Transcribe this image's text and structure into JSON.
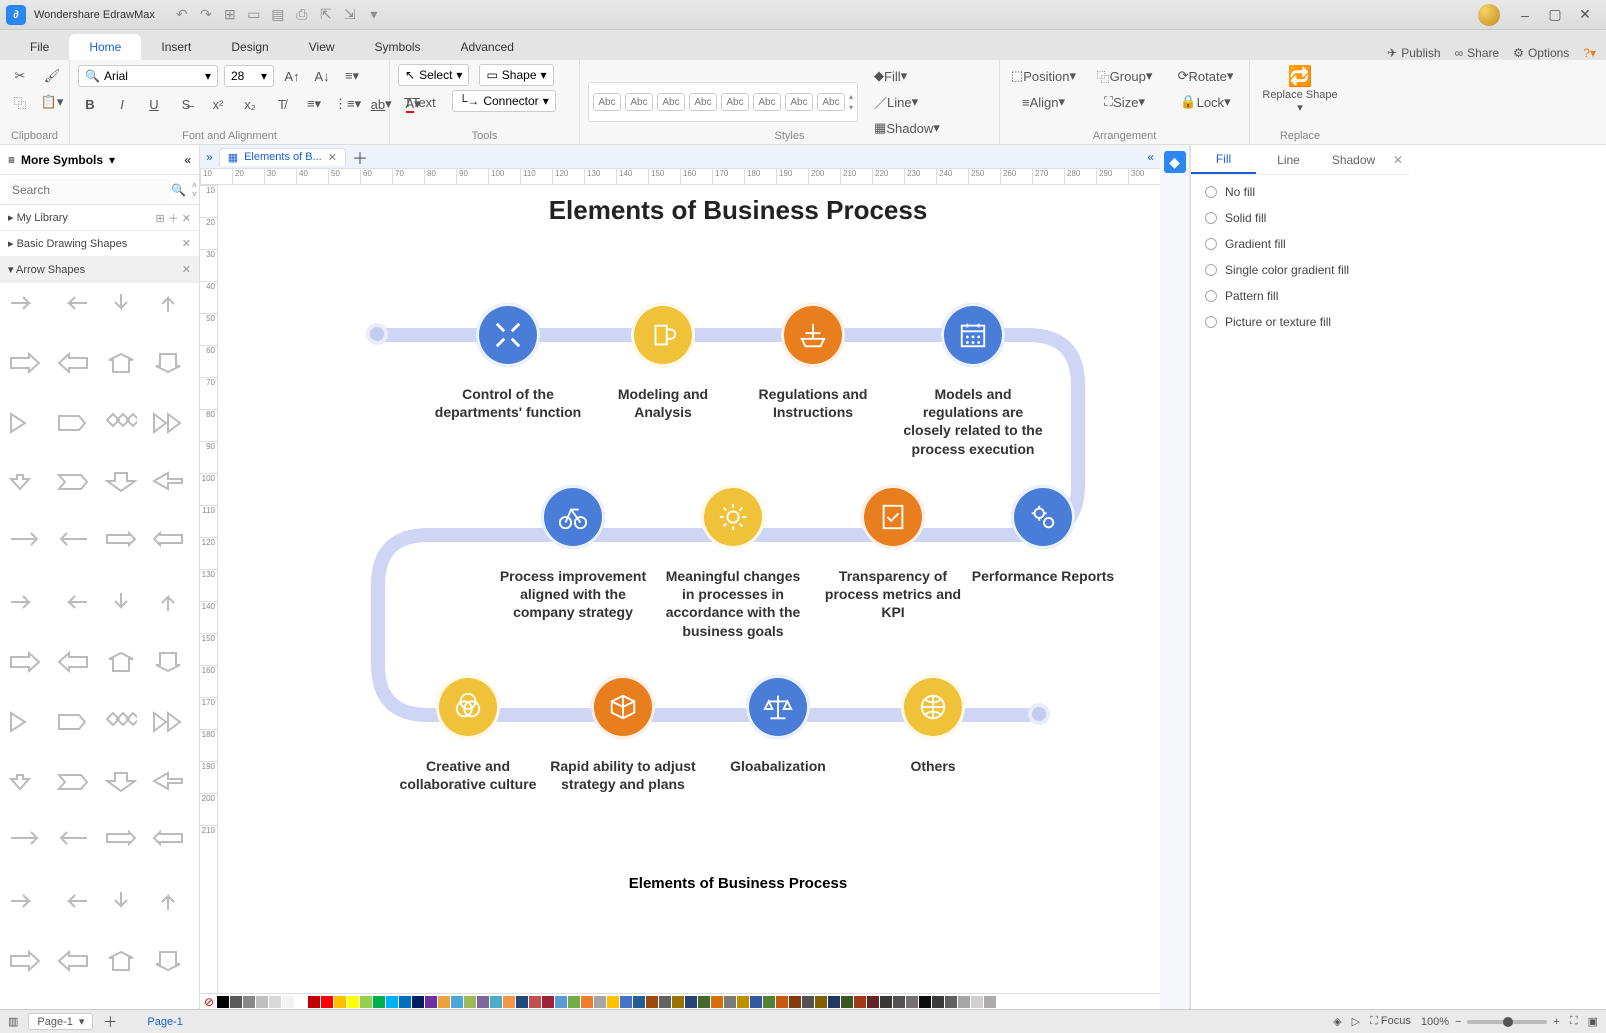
{
  "app": {
    "name": "Wondershare EdrawMax"
  },
  "window_controls": {
    "min": "–",
    "max": "▢",
    "close": "✕"
  },
  "menutabs": [
    "File",
    "Home",
    "Insert",
    "Design",
    "View",
    "Symbols",
    "Advanced"
  ],
  "menutabs_active": 1,
  "menu_right": {
    "publish": "Publish",
    "share": "Share",
    "options": "Options"
  },
  "ribbon": {
    "clipboard": {
      "label": "Clipboard"
    },
    "font": {
      "label": "Font and Alignment",
      "font_name": "Arial",
      "font_size": "28"
    },
    "tools": {
      "label": "Tools",
      "select": "Select",
      "shape": "Shape",
      "text": "Text",
      "connector": "Connector"
    },
    "styles": {
      "label": "Styles",
      "swatch_text": "Abc"
    },
    "fill_line": {
      "fill": "Fill",
      "line": "Line",
      "shadow": "Shadow"
    },
    "arrangement": {
      "label": "Arrangement",
      "position": "Position",
      "group": "Group",
      "rotate": "Rotate",
      "align": "Align",
      "size": "Size",
      "lock": "Lock"
    },
    "replace": {
      "label": "Replace",
      "btn": "Replace Shape"
    }
  },
  "left": {
    "more_symbols": "More Symbols",
    "search_placeholder": "Search",
    "cats": [
      "My Library",
      "Basic Drawing Shapes",
      "Arrow Shapes"
    ],
    "cat_active": 2
  },
  "doc": {
    "tab_name": "Elements of B...",
    "title": "Elements of Business Process",
    "caption": "Elements of Business Process",
    "nodes_row1": [
      {
        "color": "blue",
        "label": "Control of the departments' function",
        "icon": "collapse"
      },
      {
        "color": "yellow",
        "label": "Modeling and Analysis",
        "icon": "beer"
      },
      {
        "color": "orange",
        "label": "Regulations and Instructions",
        "icon": "ship"
      },
      {
        "color": "blue",
        "label": "Models and regulations are closely related to the process execution",
        "icon": "calendar"
      }
    ],
    "nodes_row2": [
      {
        "color": "blue",
        "label": "Process improvement aligned with the company strategy",
        "icon": "bike"
      },
      {
        "color": "yellow",
        "label": "Meaningful changes in processes in accordance with the business goals",
        "icon": "bulb"
      },
      {
        "color": "orange",
        "label": "Transparency of process metrics and KPI",
        "icon": "clipboard"
      },
      {
        "color": "blue",
        "label": "Performance Reports",
        "icon": "gears"
      }
    ],
    "nodes_row3": [
      {
        "color": "yellow",
        "label": "Creative and collaborative culture",
        "icon": "venn"
      },
      {
        "color": "orange",
        "label": "Rapid ability to adjust strategy and plans",
        "icon": "cube"
      },
      {
        "color": "blue",
        "label": "Gloabalization",
        "icon": "scale"
      },
      {
        "color": "yellow",
        "label": "Others",
        "icon": "globe"
      }
    ]
  },
  "right": {
    "tabs": [
      "Fill",
      "Line",
      "Shadow"
    ],
    "tabs_active": 0,
    "options": [
      "No fill",
      "Solid fill",
      "Gradient fill",
      "Single color gradient fill",
      "Pattern fill",
      "Picture or texture fill"
    ]
  },
  "status": {
    "page_sel": "Page-1",
    "page_link": "Page-1",
    "focus": "Focus",
    "zoom": "100%"
  },
  "ruler_h": [
    "10",
    "20",
    "30",
    "40",
    "50",
    "60",
    "70",
    "80",
    "90",
    "100",
    "110",
    "120",
    "130",
    "140",
    "150",
    "160",
    "170",
    "180",
    "190",
    "200",
    "210",
    "220",
    "230",
    "240",
    "250",
    "260",
    "270",
    "280",
    "290",
    "300"
  ],
  "ruler_v": [
    "10",
    "20",
    "30",
    "40",
    "50",
    "60",
    "70",
    "80",
    "90",
    "100",
    "110",
    "120",
    "130",
    "140",
    "150",
    "160",
    "170",
    "180",
    "190",
    "200",
    "210"
  ],
  "colorbar": [
    "#000",
    "#595959",
    "#888",
    "#bfbfbf",
    "#d9d9d9",
    "#f2f2f2",
    "#fff",
    "#c00000",
    "#f00",
    "#ffc000",
    "#ffff00",
    "#92d050",
    "#00b050",
    "#00b0f0",
    "#0070c0",
    "#002060",
    "#7030a0",
    "#e8a33d",
    "#4aa8d8",
    "#9bbb59",
    "#8064a2",
    "#4bacc6",
    "#f79646",
    "#1f497d",
    "#c0504d",
    "#9b2335",
    "#5b9bd5",
    "#70ad47",
    "#ed7d31",
    "#a5a5a5",
    "#ffc000",
    "#4472c4",
    "#255e91",
    "#9e480e",
    "#636363",
    "#997300",
    "#264478",
    "#43682b",
    "#d86d0c",
    "#7b7b7b",
    "#bf8f00",
    "#335aa1",
    "#548235",
    "#c55a11",
    "#843c0c",
    "#525252",
    "#806000",
    "#203864",
    "#385723",
    "#9e3a17",
    "#632523",
    "#3b3838",
    "#525252",
    "#767171",
    "#0d0d0d",
    "#3a3a3a",
    "#606060",
    "#a6a6a6",
    "#d0cece",
    "#aeabab"
  ]
}
